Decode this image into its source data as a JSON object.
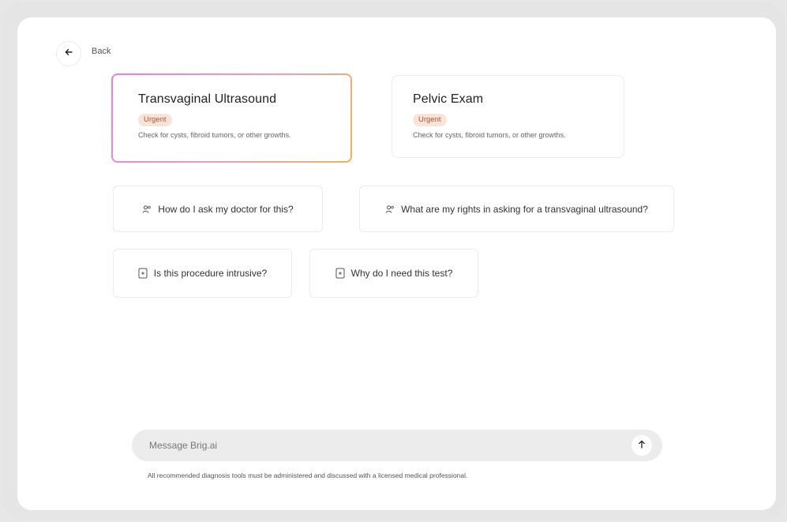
{
  "nav": {
    "back_label": "Back"
  },
  "cards": [
    {
      "title": "Transvaginal Ultrasound",
      "badge": "Urgent",
      "description": "Check for cysts, fibroid tumors, or other growths.",
      "selected": true
    },
    {
      "title": "Pelvic Exam",
      "badge": "Urgent",
      "description": "Check for cysts, fibroid tumors, or other growths.",
      "selected": false
    }
  ],
  "suggestions": [
    {
      "label": "How do I ask my doctor for this?",
      "icon": "people-icon"
    },
    {
      "label": "What are my rights in asking for a transvaginal ultrasound?",
      "icon": "people-icon"
    },
    {
      "label": "Is this procedure intrusive?",
      "icon": "document-icon"
    },
    {
      "label": "Why do I need this test?",
      "icon": "document-icon"
    }
  ],
  "composer": {
    "placeholder": "Message Brig.ai",
    "value": ""
  },
  "disclaimer": "All recommended diagnosis tools must be administered and discussed with a licensed medical professional.",
  "colors": {
    "selected_border_gradient": [
      "#f27bd9",
      "#f59bb6",
      "#f5b153"
    ],
    "badge_bg": "#fbe3d8",
    "badge_text": "#b4523d"
  }
}
